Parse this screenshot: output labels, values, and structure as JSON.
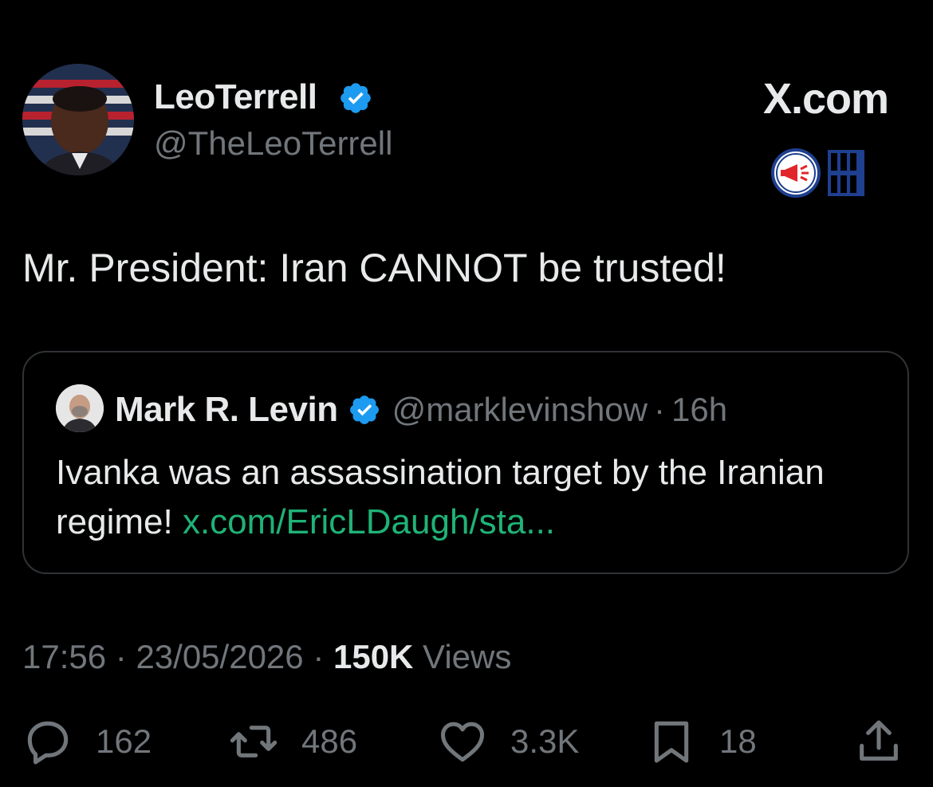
{
  "author": {
    "name": "LeoTerrell",
    "handle": "@TheLeoTerrell",
    "verified": true,
    "avatar": "portrait-avatar"
  },
  "brand": {
    "site": "X.com",
    "watermark_icon": "megaphone-clock-logo"
  },
  "tweet": {
    "text": "Mr. President: Iran CANNOT be trusted!"
  },
  "quote": {
    "name": "Mark R. Levin",
    "handle": "@marklevinshow",
    "separator": "·",
    "time": "16h",
    "text": "Ivanka was an assassination target by the Iranian regime! ",
    "link": "x.com/EricLDaugh/sta..."
  },
  "meta": {
    "time": "17:56",
    "sep1": " · ",
    "date": "23/05/2026",
    "sep2": " · ",
    "views_count": "150K",
    "views_label": " Views"
  },
  "actions": {
    "replies": "162",
    "reposts": "486",
    "likes": "3.3K",
    "bookmarks": "18"
  },
  "colors": {
    "background": "#000000",
    "text": "#e7e9ea",
    "secondary": "#71767b",
    "verified": "#1d9bf0",
    "link": "#1fb377"
  }
}
